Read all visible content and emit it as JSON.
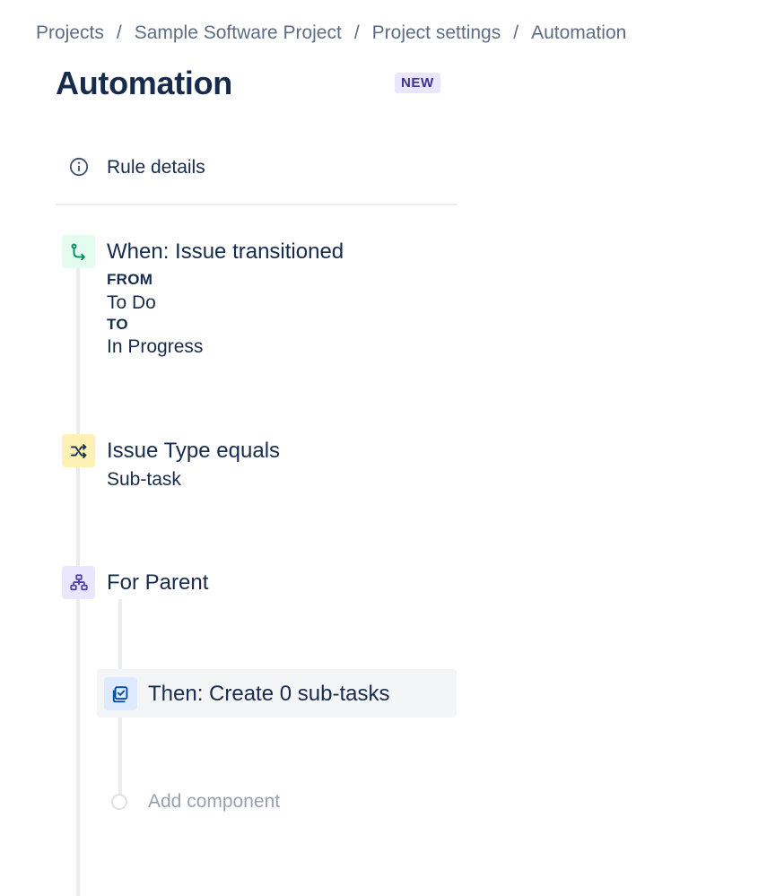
{
  "breadcrumb": {
    "items": [
      "Projects",
      "Sample Software Project",
      "Project settings",
      "Automation"
    ],
    "separator": "/"
  },
  "page": {
    "title": "Automation",
    "badge": "NEW"
  },
  "rule_details": {
    "label": "Rule details",
    "icon": "info-icon"
  },
  "trigger": {
    "title": "When: Issue transitioned",
    "from_label": "FROM",
    "from_value": "To Do",
    "to_label": "TO",
    "to_value": "In Progress",
    "icon": "transition-icon",
    "color": "#00875a"
  },
  "condition": {
    "title": "Issue Type equals",
    "value": "Sub-task",
    "icon": "shuffle-icon",
    "color": "#172b4d"
  },
  "branch": {
    "title": "For Parent",
    "icon": "hierarchy-icon",
    "color": "#5243aa"
  },
  "action": {
    "title": "Then: Create 0 sub-tasks",
    "icon": "checkbox-icon",
    "color": "#0747a6"
  },
  "add_component": {
    "label": "Add component"
  }
}
